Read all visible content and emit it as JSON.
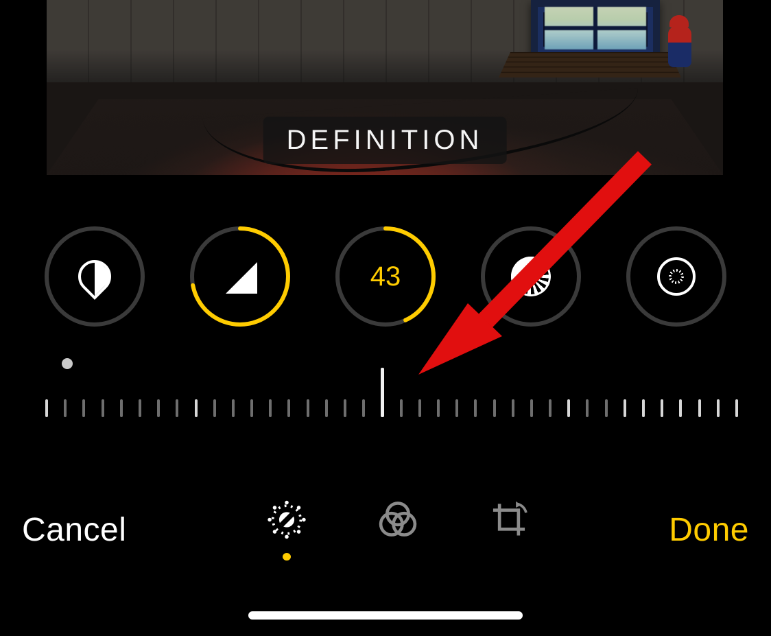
{
  "overlay": {
    "label": "DEFINITION"
  },
  "adjustments": {
    "selected": "definition",
    "definition_value": "43",
    "items": [
      {
        "id": "tint",
        "progress": 0
      },
      {
        "id": "sharpness",
        "progress": 0.72
      },
      {
        "id": "definition",
        "progress": 0.43
      },
      {
        "id": "noise",
        "progress": 0
      },
      {
        "id": "vignette",
        "progress": 0
      }
    ]
  },
  "slider": {
    "dot_position_pct": 3,
    "center_index": 18,
    "tick_count": 38
  },
  "bottom": {
    "cancel_label": "Cancel",
    "done_label": "Done",
    "active_mode": "adjust"
  },
  "colors": {
    "accent": "#ffcc00",
    "annotation": "#e10f0f"
  }
}
